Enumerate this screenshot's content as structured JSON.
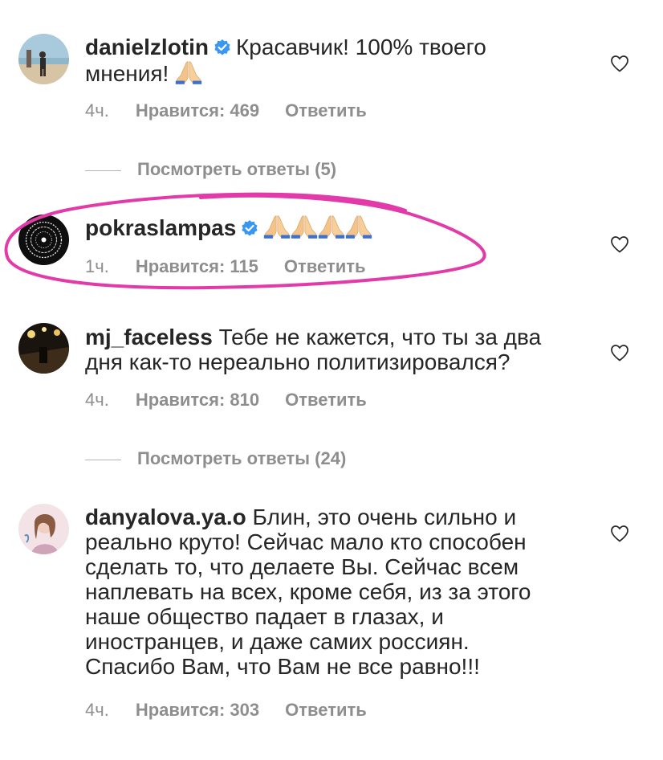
{
  "comments": [
    {
      "username": "danielzlotin",
      "verified": true,
      "text_line1": "Красавчик! 100% твоего",
      "text_line2": "мнения! ",
      "emoji_count": 1,
      "time": "4ч.",
      "likes": "Нравится: 469",
      "reply": "Ответить",
      "avatar_icon": "beach-photo-avatar"
    },
    {
      "username": "pokraslampas",
      "verified": true,
      "emoji_count": 4,
      "time": "1ч.",
      "likes": "Нравится: 115",
      "reply": "Ответить",
      "avatar_icon": "black-circle-lettering-avatar"
    },
    {
      "username": "mj_faceless",
      "verified": false,
      "text_line1": "Тебе не кажется, что ты за два",
      "text_line2": "дня как-то нереально политизировался?",
      "time": "4ч.",
      "likes": "Нравится: 810",
      "reply": "Ответить",
      "avatar_icon": "dark-stage-photo-avatar"
    },
    {
      "username": "danyalova.ya.o",
      "verified": false,
      "text_line1": "Блин, это очень сильно и",
      "text_lines": [
        "реально круто!  Сейчас мало кто способен",
        "сделать то,  что делаете Вы. Сейчас всем",
        "наплевать на всех, кроме себя, из за этого",
        "наше общество падает в глазах, и",
        "иностранцев, и даже самих россиян.",
        "Спасибо Вам,  что Вам не все равно!!!"
      ],
      "time": "4ч.",
      "likes": "Нравится: 303",
      "reply": "Ответить",
      "avatar_icon": "girl-illustration-avatar"
    }
  ],
  "view_replies": [
    "Посмотреть ответы (5)",
    "Посмотреть ответы (24)"
  ],
  "colors": {
    "text": "#262626",
    "muted": "#8e8e8e",
    "verified": "#3897f0",
    "highlight": "#e23aa8"
  },
  "icons": {
    "heart": "heart-outline-icon",
    "verified": "verified-badge-icon",
    "emoji": "folded-hands-emoji"
  }
}
